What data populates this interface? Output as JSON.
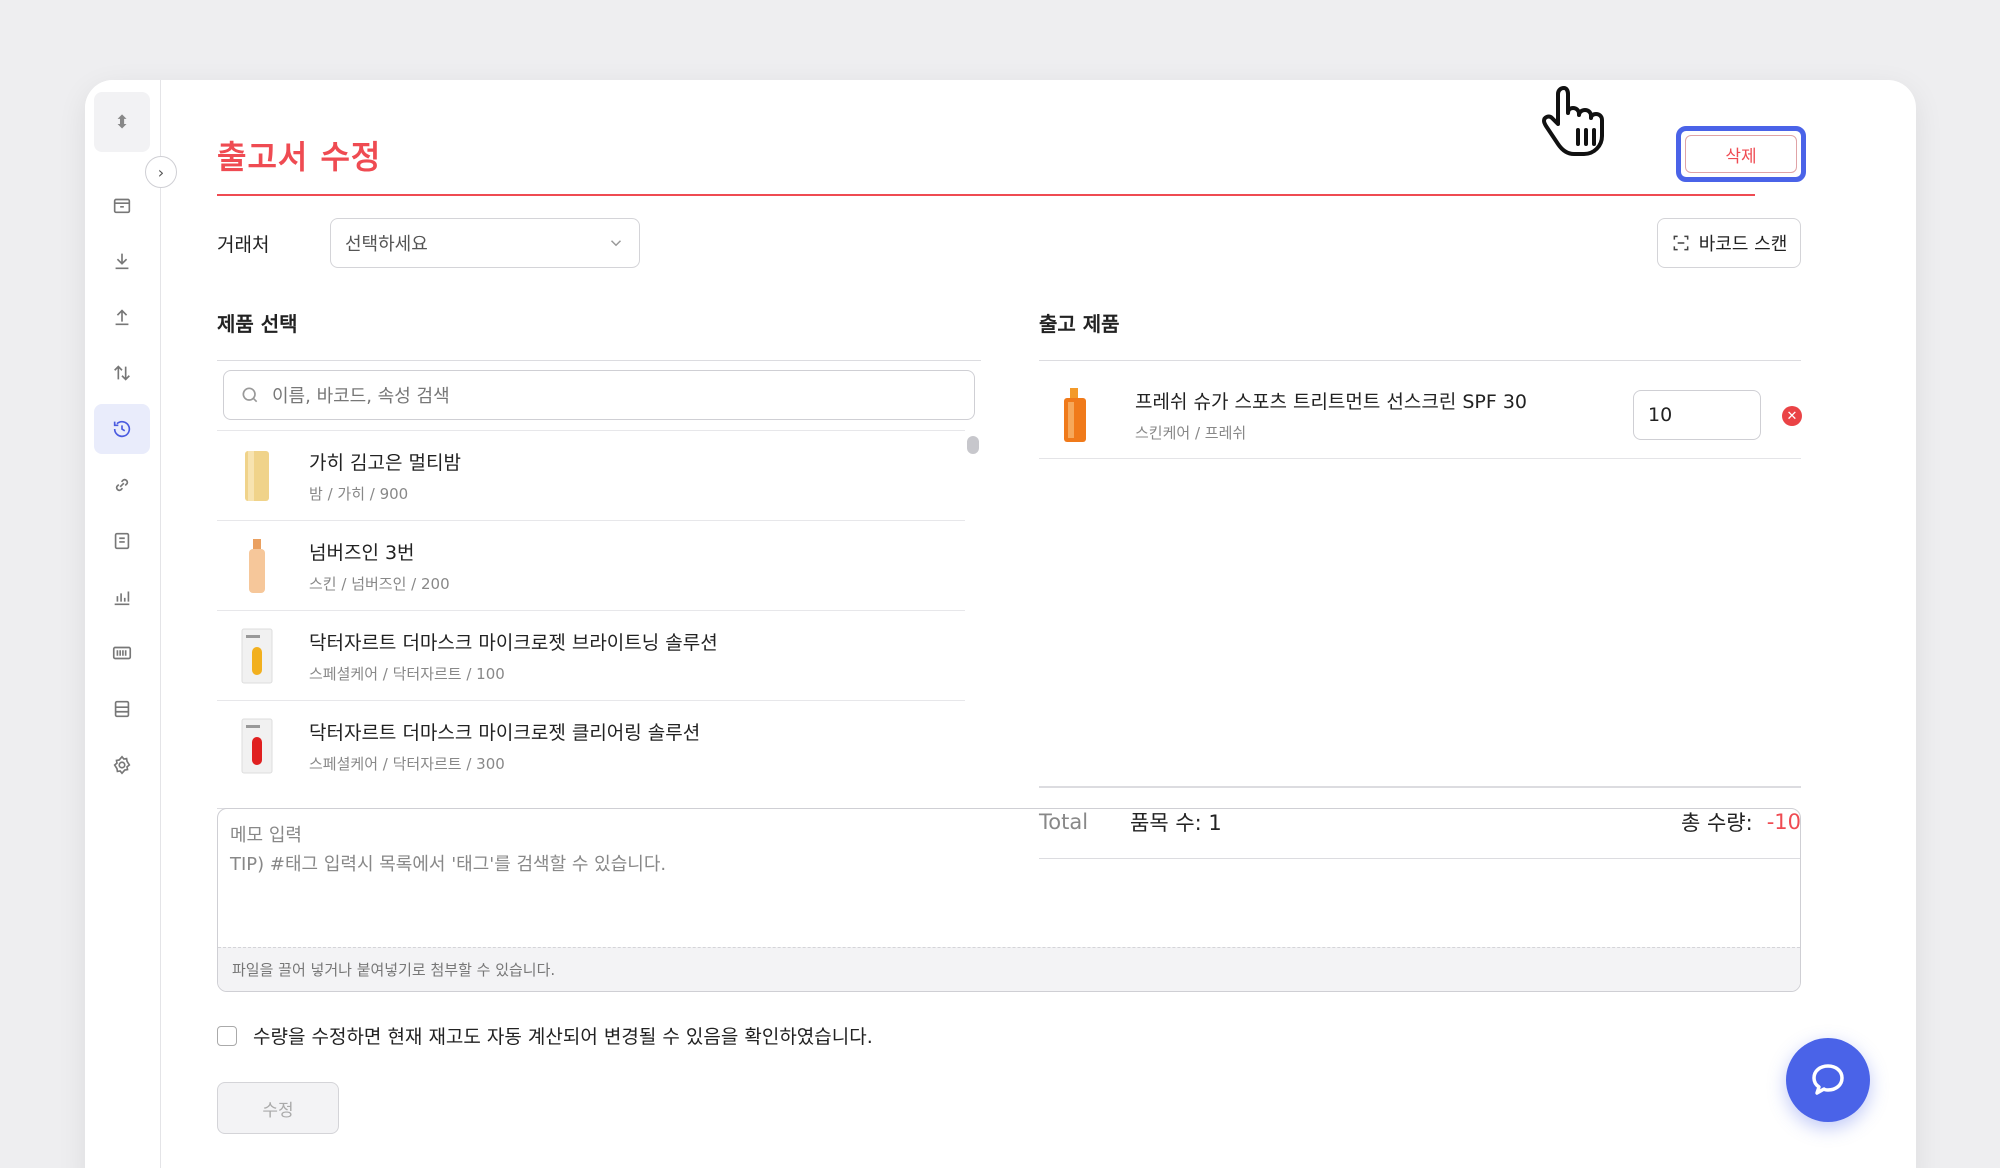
{
  "page": {
    "title": "출고서 수정",
    "delete_label": "삭제",
    "vendor_label": "거래처",
    "vendor_placeholder": "선택하세요",
    "barcode_label": "바코드 스캔"
  },
  "product_select": {
    "title": "제품 선택",
    "search_placeholder": "이름, 바코드, 속성 검색",
    "items": [
      {
        "name": "가히 김고은 멀티밤",
        "sub": "밤 / 가히 / 900"
      },
      {
        "name": "넘버즈인 3번",
        "sub": "스킨 / 넘버즈인 / 200"
      },
      {
        "name": "닥터자르트 더마스크 마이크로젯 브라이트닝 솔루션",
        "sub": "스페셜케어 / 닥터자르트 / 100"
      },
      {
        "name": "닥터자르트 더마스크 마이크로젯 클리어링 솔루션",
        "sub": "스페셜케어 / 닥터자르트 / 300"
      }
    ]
  },
  "outbound": {
    "title": "출고 제품",
    "items": [
      {
        "name": "프레쉬 슈가 스포츠 트리트먼트 선스크린 SPF 30",
        "sub": "스킨케어 / 프레쉬",
        "qty": "10"
      }
    ],
    "total_label": "Total",
    "items_count": "품목 수:  1",
    "total_qty_label": "총 수량:",
    "total_qty_value": "-10"
  },
  "memo": {
    "placeholder": "메모 입력\nTIP) #태그 입력시 목록에서 '태그'를 검색할 수 있습니다.",
    "attach_hint": "파일을 끌어 넣거나 붙여넣기로 첨부할 수 있습니다."
  },
  "confirm_text": "수량을 수정하면 현재 재고도 자동 계산되어 변경될 수 있음을 확인하였습니다.",
  "submit_label": "수정",
  "colors": {
    "accent": "#ef4b52",
    "primary": "#4a63e8"
  },
  "icons": [
    "sort-icon",
    "chevron-right-icon",
    "box-icon",
    "inbound-icon",
    "outbound-icon",
    "transfer-icon",
    "history-icon",
    "link-icon",
    "document-icon",
    "chart-icon",
    "barcode-icon",
    "list-icon",
    "settings-icon",
    "search-icon",
    "chevron-down-icon",
    "scan-icon",
    "close-icon",
    "hand-cursor-icon",
    "chat-icon"
  ]
}
